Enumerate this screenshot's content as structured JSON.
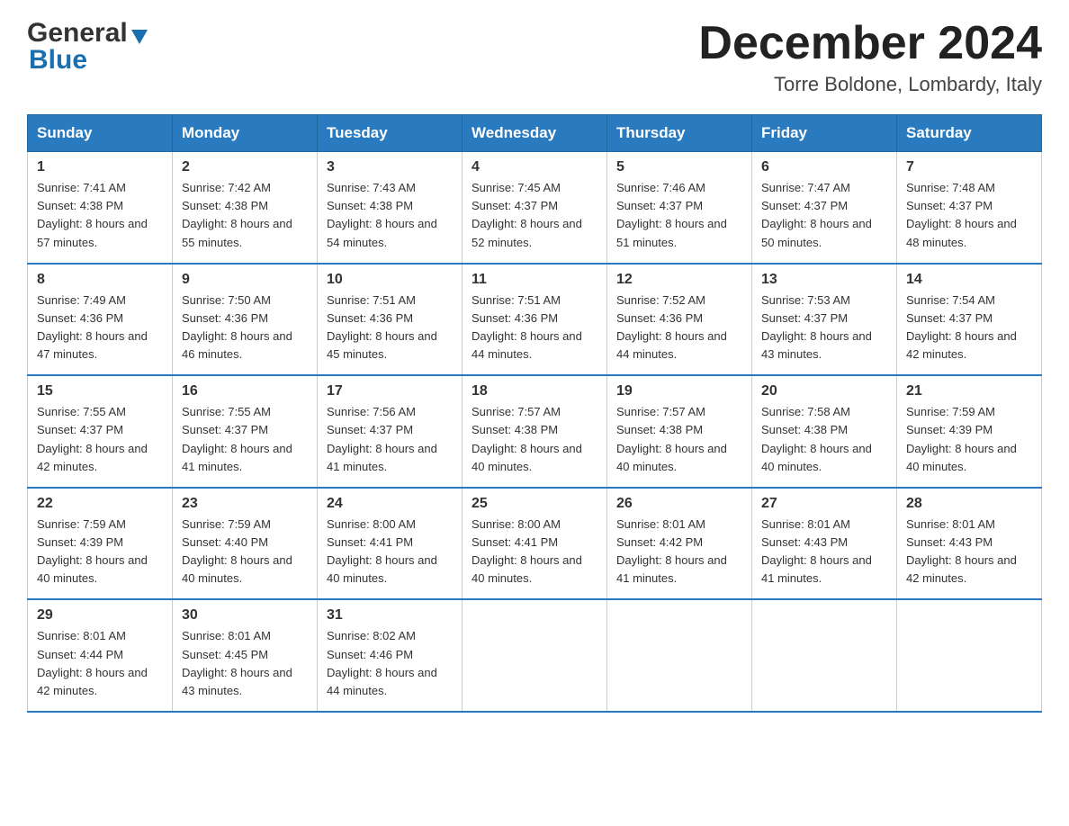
{
  "header": {
    "logo_general": "General",
    "logo_blue": "Blue",
    "month_title": "December 2024",
    "subtitle": "Torre Boldone, Lombardy, Italy"
  },
  "weekdays": [
    "Sunday",
    "Monday",
    "Tuesday",
    "Wednesday",
    "Thursday",
    "Friday",
    "Saturday"
  ],
  "weeks": [
    [
      {
        "day": "1",
        "sunrise": "7:41 AM",
        "sunset": "4:38 PM",
        "daylight": "8 hours and 57 minutes."
      },
      {
        "day": "2",
        "sunrise": "7:42 AM",
        "sunset": "4:38 PM",
        "daylight": "8 hours and 55 minutes."
      },
      {
        "day": "3",
        "sunrise": "7:43 AM",
        "sunset": "4:38 PM",
        "daylight": "8 hours and 54 minutes."
      },
      {
        "day": "4",
        "sunrise": "7:45 AM",
        "sunset": "4:37 PM",
        "daylight": "8 hours and 52 minutes."
      },
      {
        "day": "5",
        "sunrise": "7:46 AM",
        "sunset": "4:37 PM",
        "daylight": "8 hours and 51 minutes."
      },
      {
        "day": "6",
        "sunrise": "7:47 AM",
        "sunset": "4:37 PM",
        "daylight": "8 hours and 50 minutes."
      },
      {
        "day": "7",
        "sunrise": "7:48 AM",
        "sunset": "4:37 PM",
        "daylight": "8 hours and 48 minutes."
      }
    ],
    [
      {
        "day": "8",
        "sunrise": "7:49 AM",
        "sunset": "4:36 PM",
        "daylight": "8 hours and 47 minutes."
      },
      {
        "day": "9",
        "sunrise": "7:50 AM",
        "sunset": "4:36 PM",
        "daylight": "8 hours and 46 minutes."
      },
      {
        "day": "10",
        "sunrise": "7:51 AM",
        "sunset": "4:36 PM",
        "daylight": "8 hours and 45 minutes."
      },
      {
        "day": "11",
        "sunrise": "7:51 AM",
        "sunset": "4:36 PM",
        "daylight": "8 hours and 44 minutes."
      },
      {
        "day": "12",
        "sunrise": "7:52 AM",
        "sunset": "4:36 PM",
        "daylight": "8 hours and 44 minutes."
      },
      {
        "day": "13",
        "sunrise": "7:53 AM",
        "sunset": "4:37 PM",
        "daylight": "8 hours and 43 minutes."
      },
      {
        "day": "14",
        "sunrise": "7:54 AM",
        "sunset": "4:37 PM",
        "daylight": "8 hours and 42 minutes."
      }
    ],
    [
      {
        "day": "15",
        "sunrise": "7:55 AM",
        "sunset": "4:37 PM",
        "daylight": "8 hours and 42 minutes."
      },
      {
        "day": "16",
        "sunrise": "7:55 AM",
        "sunset": "4:37 PM",
        "daylight": "8 hours and 41 minutes."
      },
      {
        "day": "17",
        "sunrise": "7:56 AM",
        "sunset": "4:37 PM",
        "daylight": "8 hours and 41 minutes."
      },
      {
        "day": "18",
        "sunrise": "7:57 AM",
        "sunset": "4:38 PM",
        "daylight": "8 hours and 40 minutes."
      },
      {
        "day": "19",
        "sunrise": "7:57 AM",
        "sunset": "4:38 PM",
        "daylight": "8 hours and 40 minutes."
      },
      {
        "day": "20",
        "sunrise": "7:58 AM",
        "sunset": "4:38 PM",
        "daylight": "8 hours and 40 minutes."
      },
      {
        "day": "21",
        "sunrise": "7:59 AM",
        "sunset": "4:39 PM",
        "daylight": "8 hours and 40 minutes."
      }
    ],
    [
      {
        "day": "22",
        "sunrise": "7:59 AM",
        "sunset": "4:39 PM",
        "daylight": "8 hours and 40 minutes."
      },
      {
        "day": "23",
        "sunrise": "7:59 AM",
        "sunset": "4:40 PM",
        "daylight": "8 hours and 40 minutes."
      },
      {
        "day": "24",
        "sunrise": "8:00 AM",
        "sunset": "4:41 PM",
        "daylight": "8 hours and 40 minutes."
      },
      {
        "day": "25",
        "sunrise": "8:00 AM",
        "sunset": "4:41 PM",
        "daylight": "8 hours and 40 minutes."
      },
      {
        "day": "26",
        "sunrise": "8:01 AM",
        "sunset": "4:42 PM",
        "daylight": "8 hours and 41 minutes."
      },
      {
        "day": "27",
        "sunrise": "8:01 AM",
        "sunset": "4:43 PM",
        "daylight": "8 hours and 41 minutes."
      },
      {
        "day": "28",
        "sunrise": "8:01 AM",
        "sunset": "4:43 PM",
        "daylight": "8 hours and 42 minutes."
      }
    ],
    [
      {
        "day": "29",
        "sunrise": "8:01 AM",
        "sunset": "4:44 PM",
        "daylight": "8 hours and 42 minutes."
      },
      {
        "day": "30",
        "sunrise": "8:01 AM",
        "sunset": "4:45 PM",
        "daylight": "8 hours and 43 minutes."
      },
      {
        "day": "31",
        "sunrise": "8:02 AM",
        "sunset": "4:46 PM",
        "daylight": "8 hours and 44 minutes."
      },
      null,
      null,
      null,
      null
    ]
  ]
}
